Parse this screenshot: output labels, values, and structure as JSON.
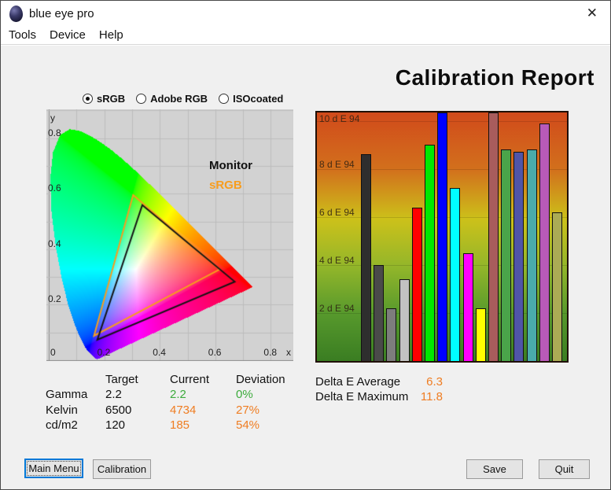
{
  "window": {
    "title": "blue eye pro",
    "close_glyph": "✕"
  },
  "menu": {
    "items": [
      "Tools",
      "Device",
      "Help"
    ]
  },
  "report": {
    "title": "Calibration Report"
  },
  "gamut_options": [
    {
      "label": "sRGB",
      "selected": true
    },
    {
      "label": "Adobe RGB",
      "selected": false
    },
    {
      "label": "ISOcoated",
      "selected": false
    }
  ],
  "chart_data": [
    {
      "type": "area",
      "name": "CIE 1931 xy chromaticity diagram with gamut triangles",
      "xlabel": "x",
      "ylabel": "y",
      "xlim": [
        0,
        0.88
      ],
      "ylim": [
        0,
        0.9
      ],
      "grid": true,
      "grid_step": 0.1,
      "x_ticks": [
        "0",
        "0.2",
        "0.4",
        "0.6",
        "0.8"
      ],
      "x_tick_values": [
        0,
        0.2,
        0.4,
        0.6,
        0.8
      ],
      "y_ticks": [
        "0.2",
        "0.4",
        "0.6",
        "0.8"
      ],
      "y_tick_values": [
        0.2,
        0.4,
        0.6,
        0.8
      ],
      "legend": {
        "position": "top-right"
      },
      "series": [
        {
          "name": "Monitor",
          "color": "#141414",
          "vertices": [
            [
              0.337,
              0.559
            ],
            [
              0.67,
              0.283
            ],
            [
              0.175,
              0.074
            ]
          ]
        },
        {
          "name": "sRGB",
          "color": "#f79d1e",
          "vertices": [
            [
              0.304,
              0.595
            ],
            [
              0.615,
              0.327
            ],
            [
              0.163,
              0.088
            ]
          ]
        }
      ]
    },
    {
      "type": "bar",
      "name": "Delta E 94 per test patch",
      "ylim": [
        0,
        10.35
      ],
      "y_ticks": [
        2,
        4,
        6,
        8,
        10
      ],
      "y_tick_labels": [
        "2 d E 94",
        "4 d E 94",
        "6 d E 94",
        "8 d E 94",
        "10 d E 94"
      ],
      "categories": [
        "black",
        "dark-gray",
        "gray",
        "light-gray",
        "red",
        "green",
        "blue",
        "cyan",
        "magenta",
        "yellow",
        "brown",
        "medium-green",
        "slate-blue",
        "teal",
        "orchid",
        "olive"
      ],
      "values": [
        8.6,
        4.0,
        2.2,
        3.4,
        6.4,
        9.0,
        11.8,
        7.2,
        4.5,
        2.2,
        11.0,
        8.8,
        8.7,
        8.8,
        9.9,
        6.2
      ],
      "bar_colors": [
        "#2e2e2e",
        "#4a4a4a",
        "#7d7d7d",
        "#c2c2c2",
        "#ff0000",
        "#00e800",
        "#0000ff",
        "#00ffff",
        "#ff00ff",
        "#ffff00",
        "#a85c5c",
        "#4aa44a",
        "#5055a8",
        "#4aabab",
        "#b85ab8",
        "#abab55"
      ],
      "note": "blue and brown bars exceed the visible scale and are clipped at the chart top",
      "background_gradient": [
        {
          "c": "#d14a1b",
          "p": 0
        },
        {
          "c": "#d2701c",
          "p": 23
        },
        {
          "c": "#ccc11a",
          "p": 43
        },
        {
          "c": "#93b62a",
          "p": 62
        },
        {
          "c": "#57992c",
          "p": 81
        },
        {
          "c": "#3a7d22",
          "p": 100
        }
      ]
    }
  ],
  "measurements": {
    "headers": [
      "Target",
      "Current",
      "Deviation"
    ],
    "rows": [
      {
        "label": "Gamma",
        "target": "2.2",
        "current": "2.2",
        "deviation": "0%",
        "status": "good"
      },
      {
        "label": "Kelvin",
        "target": "6500",
        "current": "4734",
        "deviation": "27%",
        "status": "bad"
      },
      {
        "label": "cd/m2",
        "target": "120",
        "current": "185",
        "deviation": "54%",
        "status": "bad"
      }
    ],
    "status_colors": {
      "good": "#3cab3c",
      "bad": "#ef7d22"
    }
  },
  "delta_e": {
    "average_label": "Delta E Average",
    "average_value": "6.3",
    "maximum_label": "Delta E Maximum",
    "maximum_value": "11.8"
  },
  "buttons": {
    "main_menu": "Main Menu",
    "calibration": "Calibration",
    "save": "Save",
    "quit": "Quit"
  }
}
